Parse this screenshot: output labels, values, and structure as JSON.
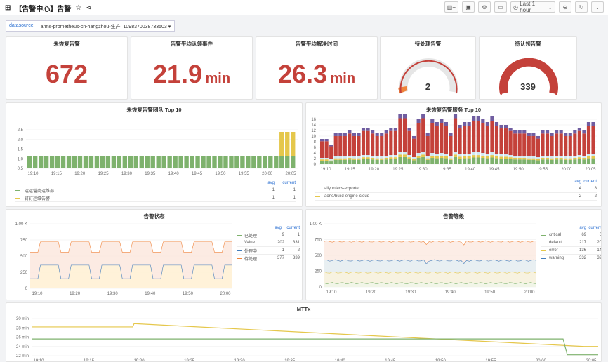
{
  "header": {
    "title": "【告警中心】告警",
    "time_label": "Last 1 hour"
  },
  "variables": {
    "label": "datasource",
    "value": "arms-prometheus-cn-hangzhou-生产_1098370038733503"
  },
  "stats": [
    {
      "title": "未恢复告警",
      "value": "672",
      "unit": ""
    },
    {
      "title": "告警平均认领事件",
      "value": "21.9",
      "unit": "min"
    },
    {
      "title": "告警平均解决时间",
      "value": "26.3",
      "unit": "min"
    }
  ],
  "gauges": [
    {
      "title": "待处理告警",
      "value": "2",
      "fraction": 0.02
    },
    {
      "title": "待认领告警",
      "value": "339",
      "fraction": 1
    }
  ],
  "colors": {
    "red": "#c4413a",
    "green": "#7eb26d",
    "yellow": "#e5c74b",
    "blue": "#447ebc",
    "purple": "#705da0",
    "orange": "#ef843c",
    "pale_blue": "#cfe8f3"
  },
  "legend_header": {
    "avg": "avg",
    "current": "current"
  },
  "chart_data": [
    {
      "name": "team",
      "title": "未恢复告警团队 Top 10",
      "type": "bar",
      "yticks": [
        "2.5",
        "2.0",
        "1.5",
        "1.0",
        "0.5"
      ],
      "xticks": [
        "19:10",
        "19:15",
        "19:20",
        "19:25",
        "19:30",
        "19:35",
        "19:40",
        "19:45",
        "19:50",
        "19:55",
        "20:00",
        "20:05"
      ],
      "series": [
        {
          "name": "运运营商运维部",
          "avg": "1",
          "current": "1"
        },
        {
          "name": "钉钉运维告警",
          "avg": "1",
          "current": "1"
        }
      ]
    },
    {
      "name": "service",
      "title": "未恢复告警服务 Top 10",
      "type": "bar",
      "yticks": [
        "16",
        "14",
        "12",
        "10",
        "8",
        "6",
        "4",
        "2",
        "0"
      ],
      "xticks": [
        "19:10",
        "19:15",
        "19:20",
        "19:25",
        "19:30",
        "19:35",
        "19:40",
        "19:45",
        "19:50",
        "19:55",
        "20:00",
        "20:05"
      ],
      "series": [
        {
          "name": "aliyun/ecs-exporter",
          "avg": "4",
          "current": "8"
        },
        {
          "name": "aone/build-engine-cloud",
          "avg": "2",
          "current": "2"
        }
      ]
    },
    {
      "name": "status",
      "title": "告警状态",
      "type": "line",
      "yticks": [
        "1.00 K",
        "750",
        "500",
        "250",
        "0"
      ],
      "xticks": [
        "19:10",
        "19:20",
        "19:30",
        "19:40",
        "19:50",
        "20:00"
      ],
      "series": [
        {
          "name": "已处理",
          "avg": "9",
          "current": "1"
        },
        {
          "name": "Value",
          "avg": "202",
          "current": "331"
        },
        {
          "name": "处理中",
          "avg": "1",
          "current": "2"
        },
        {
          "name": "待处理",
          "avg": "377",
          "current": "339"
        }
      ]
    },
    {
      "name": "level",
      "title": "告警等级",
      "type": "line",
      "yticks": [
        "1.00 K",
        "750",
        "500",
        "250",
        "0"
      ],
      "xticks": [
        "19:10",
        "19:20",
        "19:30",
        "19:40",
        "19:50",
        "20:00"
      ],
      "series": [
        {
          "name": "critical",
          "avg": "69",
          "current": "6"
        },
        {
          "name": "default",
          "avg": "217",
          "current": "20"
        },
        {
          "name": "error",
          "avg": "136",
          "current": "14"
        },
        {
          "name": "warning",
          "avg": "332",
          "current": "32"
        }
      ]
    },
    {
      "name": "mttx",
      "title": "MTTx",
      "type": "line",
      "yticks": [
        "30 min",
        "28 min",
        "26 min",
        "24 min",
        "22 min"
      ],
      "xticks": [
        "19:10",
        "19:15",
        "19:20",
        "19:25",
        "19:30",
        "19:35",
        "19:40",
        "19:45",
        "19:50",
        "19:55",
        "20:00",
        "20:05"
      ]
    }
  ]
}
